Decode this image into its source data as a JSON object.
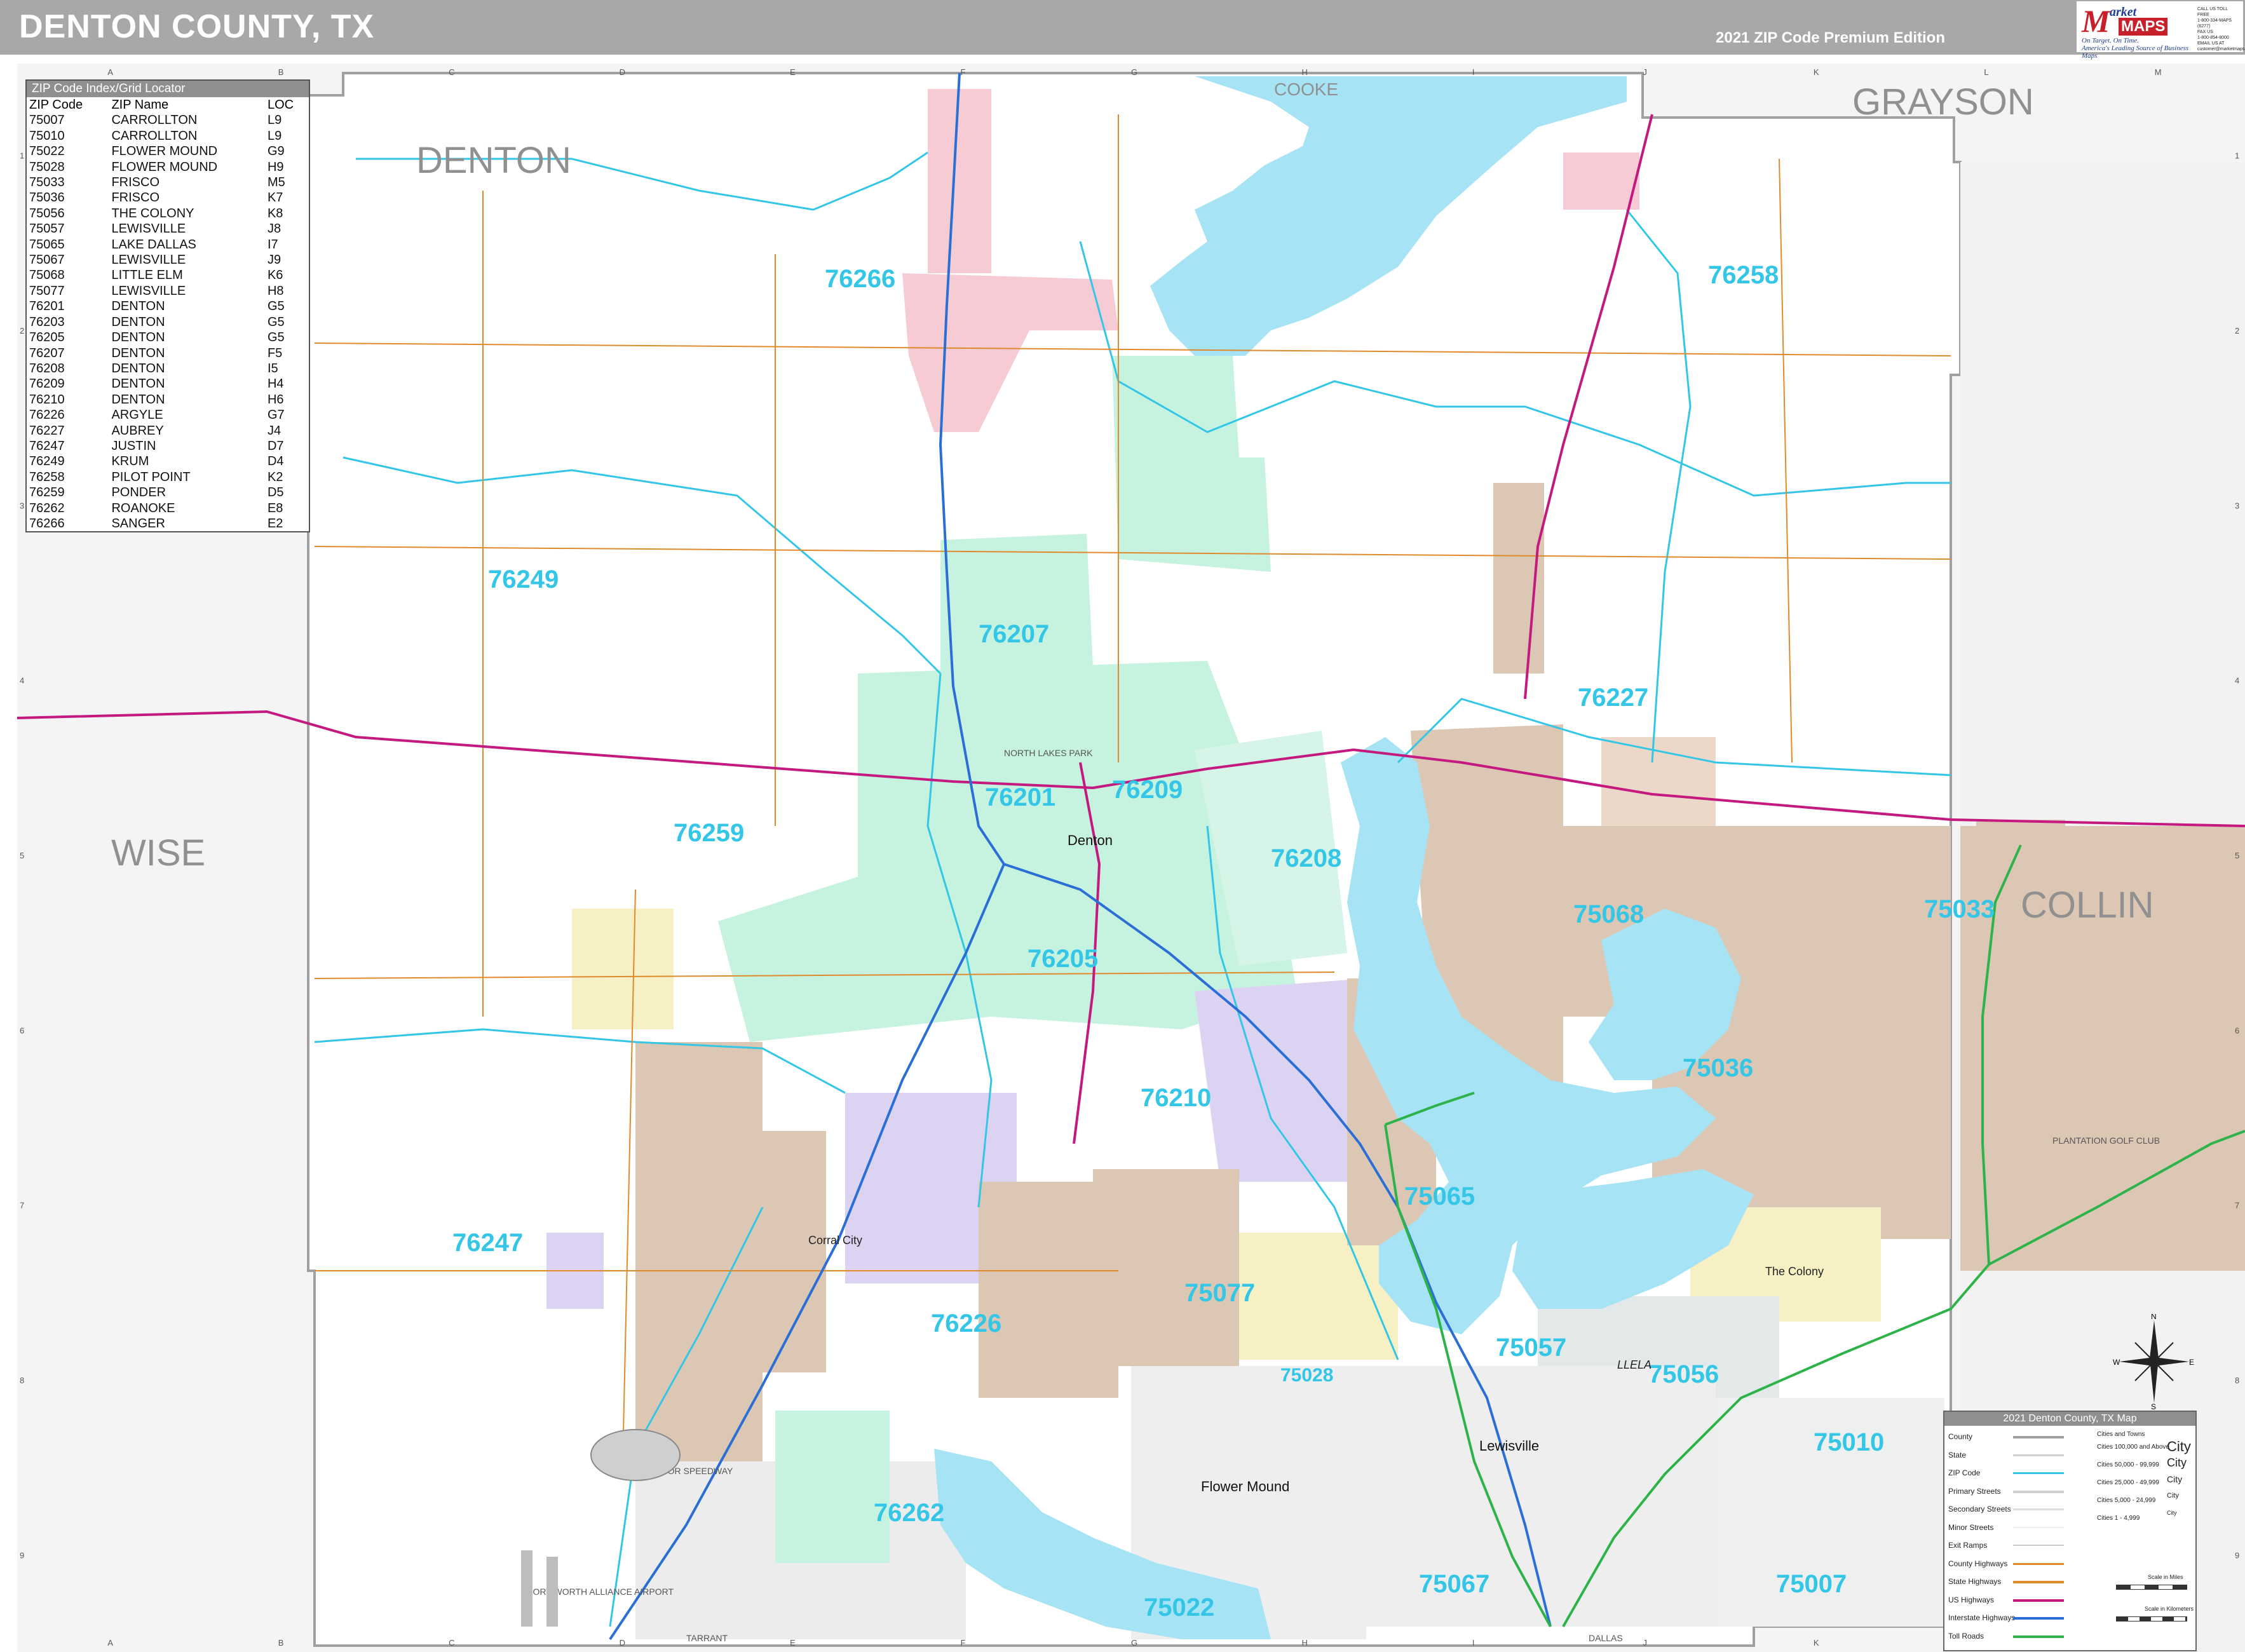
{
  "header": {
    "title": "DENTON COUNTY, TX",
    "edition": "2021 ZIP Code Premium Edition"
  },
  "publisher": {
    "logo_m": "M",
    "logo_market": "arket",
    "logo_maps": "MAPS",
    "tagline_1": "On Target. On Time.",
    "tagline_2": "America's Leading Source of Business Maps",
    "contact_1": "CALL US TOLL FREE",
    "contact_2": "1-800-334-MAPS (6277)",
    "contact_3": "FAX US",
    "contact_4": "1-800-854-8000",
    "contact_5": "EMAIL US AT",
    "contact_6": "customer@marketmaps.com"
  },
  "grid": {
    "columns": [
      "A",
      "B",
      "C",
      "D",
      "E",
      "F",
      "G",
      "H",
      "I",
      "J",
      "K",
      "L",
      "M"
    ],
    "rows": [
      "1",
      "2",
      "3",
      "4",
      "5",
      "6",
      "7",
      "8",
      "9"
    ]
  },
  "zip_index": {
    "title": "ZIP Code Index/Grid Locator",
    "headers": [
      "ZIP Code",
      "ZIP Name",
      "LOC"
    ],
    "rows": [
      [
        "75007",
        "CARROLLTON",
        "L9"
      ],
      [
        "75010",
        "CARROLLTON",
        "L9"
      ],
      [
        "75022",
        "FLOWER MOUND",
        "G9"
      ],
      [
        "75028",
        "FLOWER MOUND",
        "H9"
      ],
      [
        "75033",
        "FRISCO",
        "M5"
      ],
      [
        "75036",
        "FRISCO",
        "K7"
      ],
      [
        "75056",
        "THE COLONY",
        "K8"
      ],
      [
        "75057",
        "LEWISVILLE",
        "J8"
      ],
      [
        "75065",
        "LAKE DALLAS",
        "I7"
      ],
      [
        "75067",
        "LEWISVILLE",
        "J9"
      ],
      [
        "75068",
        "LITTLE ELM",
        "K6"
      ],
      [
        "75077",
        "LEWISVILLE",
        "H8"
      ],
      [
        "76201",
        "DENTON",
        "G5"
      ],
      [
        "76203",
        "DENTON",
        "G5"
      ],
      [
        "76205",
        "DENTON",
        "G5"
      ],
      [
        "76207",
        "DENTON",
        "F5"
      ],
      [
        "76208",
        "DENTON",
        "I5"
      ],
      [
        "76209",
        "DENTON",
        "H4"
      ],
      [
        "76210",
        "DENTON",
        "H6"
      ],
      [
        "76226",
        "ARGYLE",
        "G7"
      ],
      [
        "76227",
        "AUBREY",
        "J4"
      ],
      [
        "76247",
        "JUSTIN",
        "D7"
      ],
      [
        "76249",
        "KRUM",
        "D4"
      ],
      [
        "76258",
        "PILOT POINT",
        "K2"
      ],
      [
        "76259",
        "PONDER",
        "D5"
      ],
      [
        "76262",
        "ROANOKE",
        "E8"
      ],
      [
        "76266",
        "SANGER",
        "E2"
      ]
    ]
  },
  "counties": {
    "denton": "DENTON",
    "grayson": "GRAYSON",
    "wise": "WISE",
    "collin": "COLLIN",
    "cooke": "COOKE",
    "tarrant": "TARRANT",
    "dallas": "DALLAS"
  },
  "zip_labels": {
    "z76266": "76266",
    "z76258": "76258",
    "z76249": "76249",
    "z76207": "76207",
    "z76227": "76227",
    "z76201": "76201",
    "z76209": "76209",
    "z76259": "76259",
    "z76208": "76208",
    "z75068": "75068",
    "z75033": "75033",
    "z76205": "76205",
    "z75036": "75036",
    "z76210": "76210",
    "z75065": "75065",
    "z76247": "76247",
    "z75077": "75077",
    "z76226": "76226",
    "z75057": "75057",
    "z75028": "75028",
    "z75056": "75056",
    "z75010": "75010",
    "z76262": "76262",
    "z75067": "75067",
    "z75007": "75007",
    "z75022": "75022"
  },
  "places": {
    "denton": "Denton",
    "lewisville": "Lewisville",
    "flower_mound": "Flower Mound",
    "the_colony": "The Colony",
    "corral_city": "Corral City",
    "texas_motor_speedway": "TEXAS MOTOR SPEEDWAY",
    "fort_worth_alliance": "FORT WORTH ALLIANCE AIRPORT",
    "llela": "LLELA",
    "plantation_golf": "PLANTATION GOLF CLUB",
    "north_lakes_park": "NORTH LAKES PARK"
  },
  "legend": {
    "title": "2021 Denton County, TX Map",
    "rows": [
      "County",
      "State",
      "ZIP Code",
      "Primary Streets",
      "Secondary Streets",
      "Minor Streets",
      "Exit Ramps",
      "County Highways",
      "State Highways",
      "US Highways",
      "Interstate Highways",
      "Toll Roads"
    ],
    "cities_header": "Cities and Towns",
    "population": [
      "Cities 100,000 and Above",
      "Cities 50,000 - 99,999",
      "Cities 25,000 - 49,999",
      "Cities 5,000 - 24,999",
      "Cities 1 - 4,999"
    ],
    "city_samples": [
      "City",
      "City",
      "City",
      "City",
      "City"
    ],
    "scale_miles": "Scale in Miles",
    "scale_km": "Scale in Kilometers",
    "compass": [
      "N",
      "E",
      "S",
      "W"
    ]
  },
  "colors": {
    "water": "#a6e3f5",
    "zip_line": "#33c6e6",
    "interstate": "#2b6fd6",
    "us_highway": "#c4197f",
    "toll_road": "#2db34a",
    "state_highway": "#e08a2c",
    "county_border": "#a0a0a0",
    "green_zone": "#c6f2e0",
    "pink_zone": "#f6cbd4",
    "tan_zone": "#dcc7b4",
    "lavender_zone": "#dcd3f2",
    "yellow_zone": "#f6f0c4",
    "outside_county": "#f2f2f2"
  }
}
